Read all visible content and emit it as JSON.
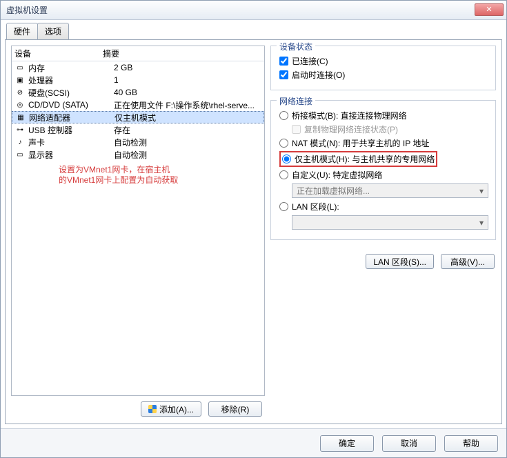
{
  "window": {
    "title": "虚拟机设置"
  },
  "tabs": {
    "hardware": "硬件",
    "options": "选项"
  },
  "devtable": {
    "h1": "设备",
    "h2": "摘要",
    "rows": [
      {
        "icon": "▭",
        "name": "内存",
        "summary": "2 GB"
      },
      {
        "icon": "▣",
        "name": "处理器",
        "summary": "1"
      },
      {
        "icon": "⊘",
        "name": "硬盘(SCSI)",
        "summary": "40 GB"
      },
      {
        "icon": "◎",
        "name": "CD/DVD (SATA)",
        "summary": "正在使用文件 F:\\操作系统\\rhel-serve..."
      },
      {
        "icon": "▦",
        "name": "网络适配器",
        "summary": "仅主机模式",
        "selected": true
      },
      {
        "icon": "⊶",
        "name": "USB 控制器",
        "summary": "存在"
      },
      {
        "icon": "♪",
        "name": "声卡",
        "summary": "自动检测"
      },
      {
        "icon": "▭",
        "name": "显示器",
        "summary": "自动检测"
      }
    ]
  },
  "annot": {
    "l1": "设置为VMnet1网卡，在宿主机",
    "l2": "的VMnet1网卡上配置为自动获取"
  },
  "left_buttons": {
    "add": "添加(A)...",
    "remove": "移除(R)"
  },
  "status": {
    "legend": "设备状态",
    "connected": "已连接(C)",
    "connect_on": "启动时连接(O)"
  },
  "net": {
    "legend": "网络连接",
    "bridged": "桥接模式(B): 直接连接物理网络",
    "replicate": "复制物理网络连接状态(P)",
    "nat": "NAT 模式(N): 用于共享主机的 IP 地址",
    "hostonly": "仅主机模式(H): 与主机共享的专用网络",
    "custom": "自定义(U): 特定虚拟网络",
    "custom_sel": "正在加载虚拟网络...",
    "lan": "LAN 区段(L):"
  },
  "right_buttons": {
    "lan": "LAN 区段(S)...",
    "adv": "高级(V)..."
  },
  "footer": {
    "ok": "确定",
    "cancel": "取消",
    "help": "帮助"
  }
}
